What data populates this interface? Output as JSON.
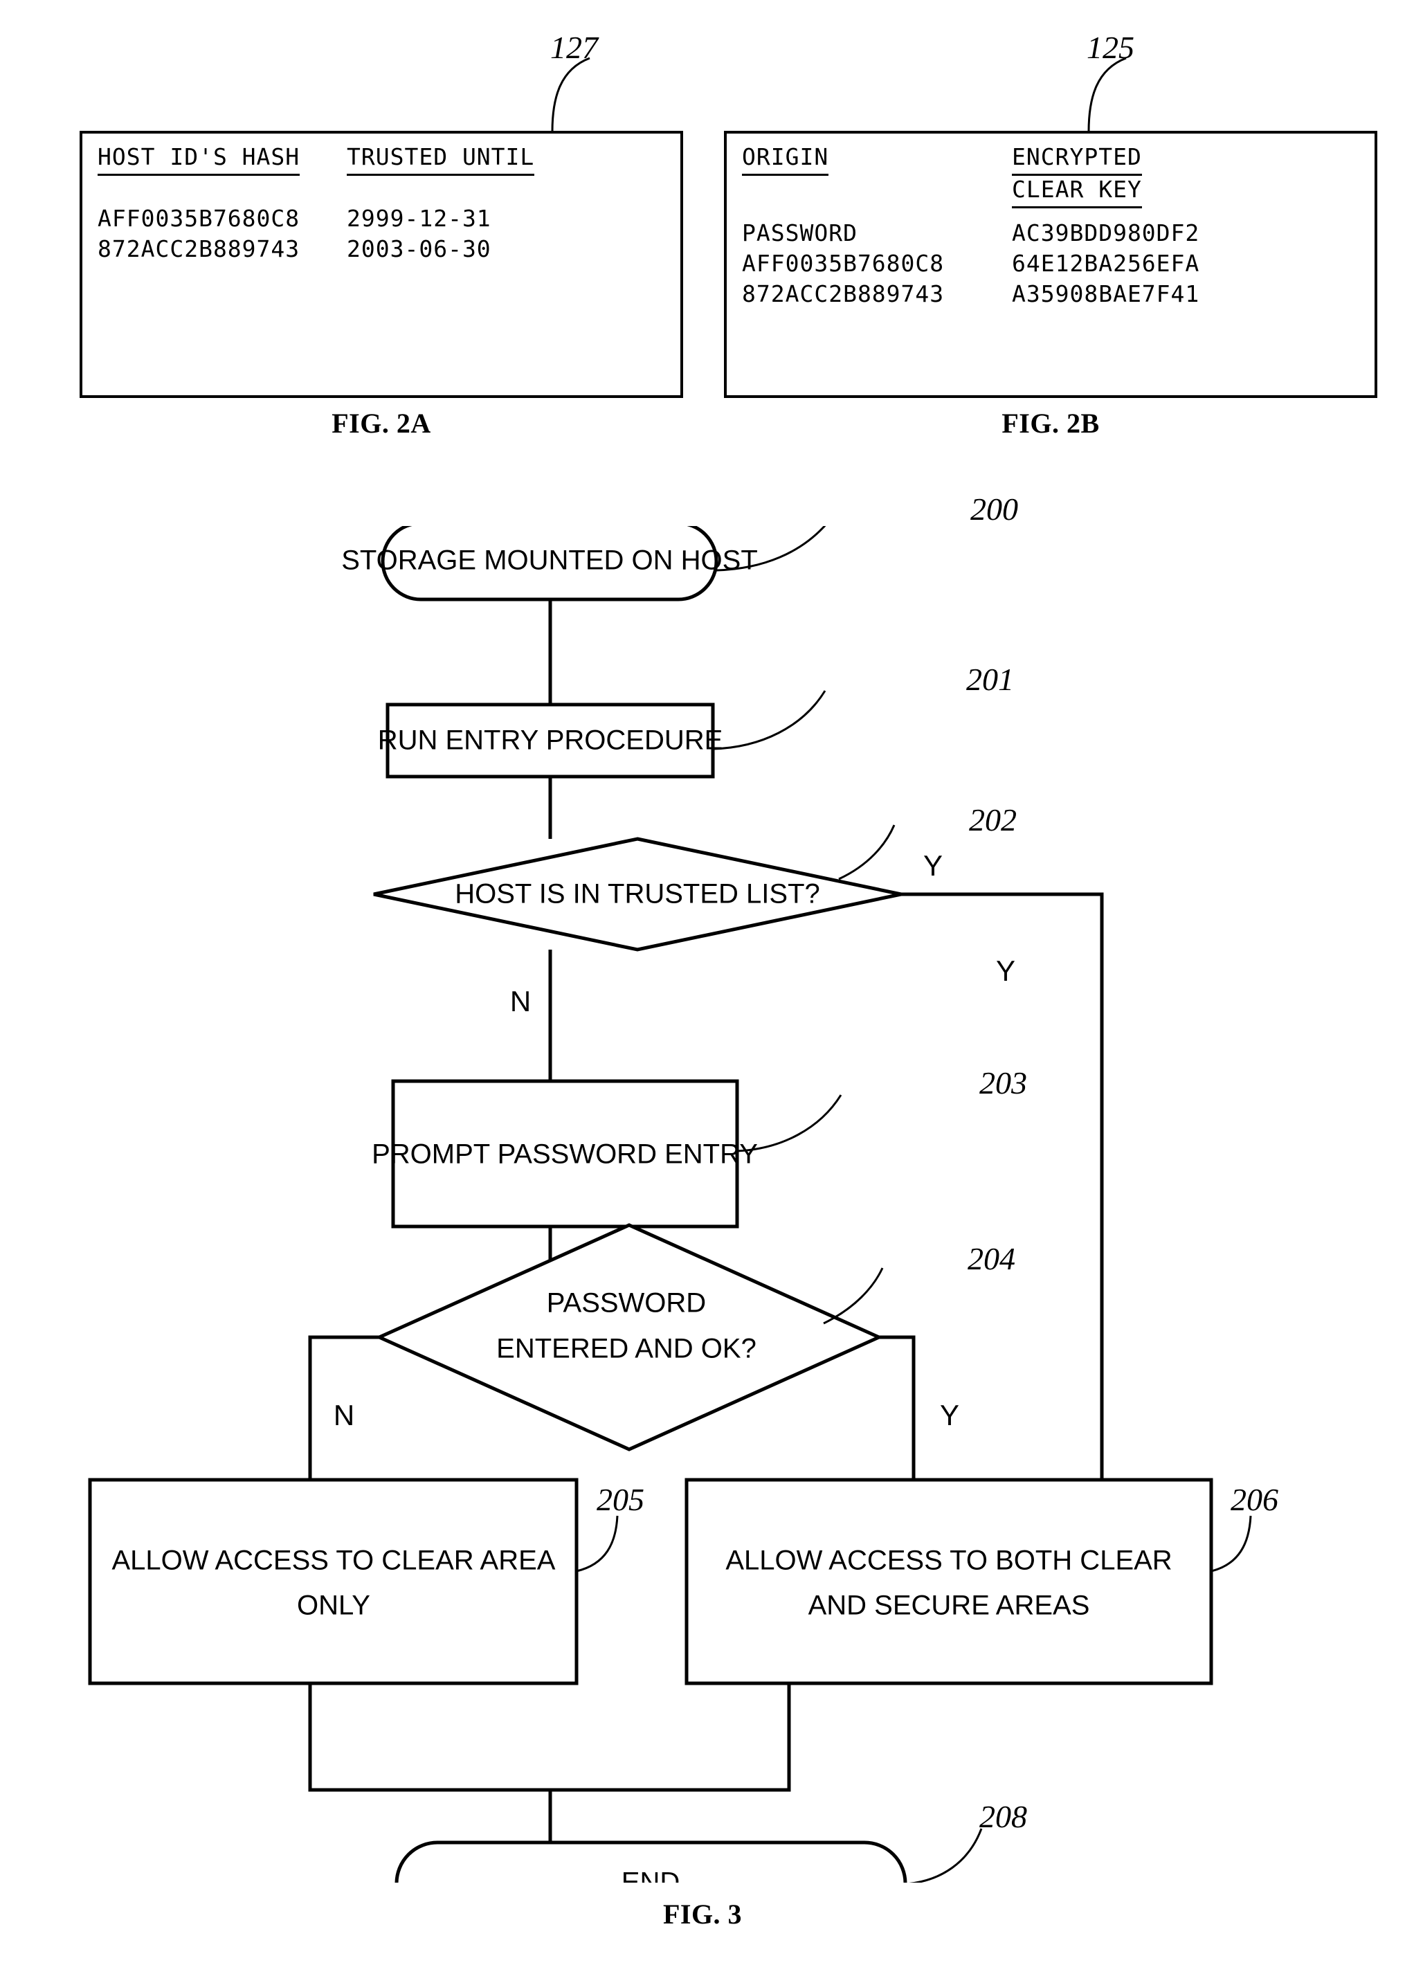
{
  "figures": {
    "fig2a": {
      "caption": "FIG. 2A",
      "ref": "127",
      "headers": [
        "HOST ID'S HASH",
        "TRUSTED UNTIL"
      ],
      "rows": [
        [
          "AFF0035B7680C8",
          "2999-12-31"
        ],
        [
          "872ACC2B889743",
          "2003-06-30"
        ]
      ]
    },
    "fig2b": {
      "caption": "FIG. 2B",
      "ref": "125",
      "headers": [
        "ORIGIN",
        [
          "ENCRYPTED",
          "CLEAR KEY"
        ]
      ],
      "header_col1": "ORIGIN",
      "header_col2_line1": "ENCRYPTED",
      "header_col2_line2": "CLEAR KEY",
      "rows": [
        [
          "PASSWORD",
          "AC39BDD980DF2"
        ],
        [
          "AFF0035B7680C8",
          "64E12BA256EFA"
        ],
        [
          "872ACC2B889743",
          "A35908BAE7F41"
        ]
      ]
    },
    "fig3": {
      "caption": "FIG. 3"
    }
  },
  "flowchart": {
    "nodes": {
      "n200": {
        "ref": "200",
        "label": "STORAGE MOUNTED ON HOST",
        "shape": "terminator"
      },
      "n201": {
        "ref": "201",
        "label": "RUN ENTRY PROCEDURE",
        "shape": "process"
      },
      "n202": {
        "ref": "202",
        "label": "HOST IS IN TRUSTED LIST?",
        "shape": "decision"
      },
      "n203": {
        "ref": "203",
        "label": "PROMPT PASSWORD ENTRY",
        "shape": "process"
      },
      "n204": {
        "ref": "204",
        "label_line1": "PASSWORD",
        "label_line2": "ENTERED AND OK?",
        "shape": "decision"
      },
      "n205": {
        "ref": "205",
        "label_line1": "ALLOW ACCESS TO CLEAR AREA",
        "label_line2": "ONLY",
        "shape": "process"
      },
      "n206": {
        "ref": "206",
        "label_line1": "ALLOW ACCESS TO BOTH CLEAR",
        "label_line2": "AND SECURE AREAS",
        "shape": "process"
      },
      "n208": {
        "ref": "208",
        "label": "END",
        "shape": "terminator"
      }
    },
    "branch_labels": {
      "b202_yes_top": "Y",
      "b202_yes_mid": "Y",
      "b202_no": "N",
      "b204_no": "N",
      "b204_yes": "Y"
    }
  },
  "colors": {
    "ink": "#000000",
    "paper": "#ffffff"
  }
}
